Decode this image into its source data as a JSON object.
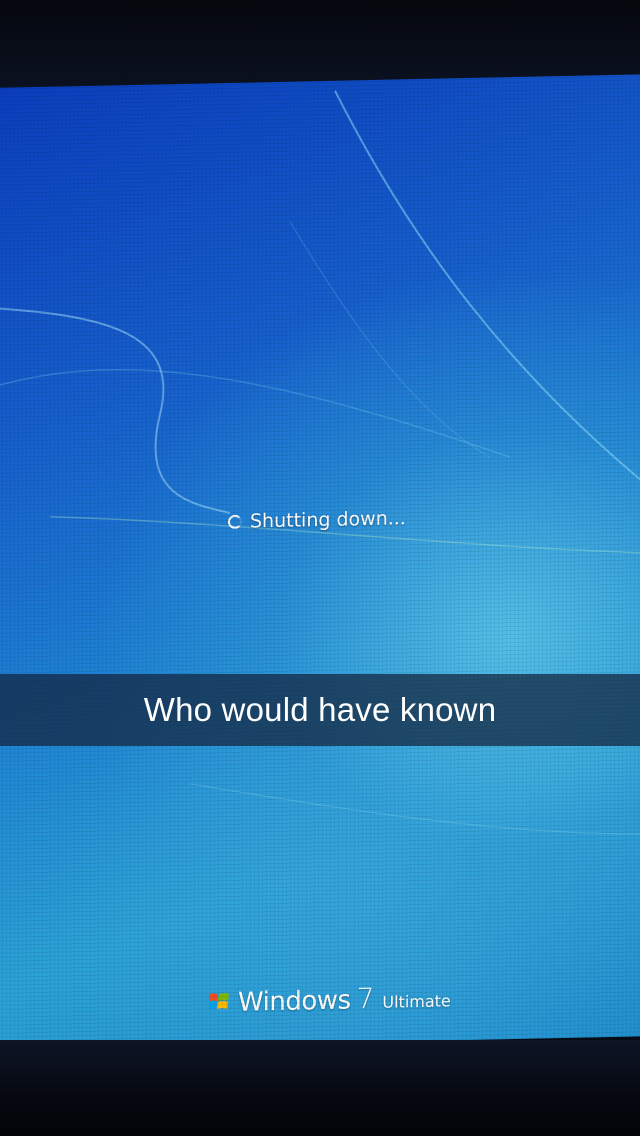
{
  "screen": {
    "status_text": "Shutting down...",
    "status_icon": "spinner-icon",
    "branding": {
      "logo_icon": "windows-logo-icon",
      "name": "Windows",
      "version": "7",
      "edition": "Ultimate"
    },
    "colors": {
      "wallpaper_dark": "#0a3ec0",
      "wallpaper_light": "#2aa3d8",
      "text": "#ffffff"
    }
  },
  "caption": {
    "text": "Who would have known",
    "bar_color": "#14233c"
  }
}
